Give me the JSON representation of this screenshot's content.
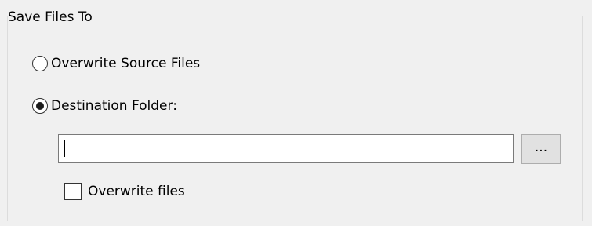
{
  "group": {
    "title": "Save Files To"
  },
  "options": {
    "overwrite_source_label": "Overwrite Source Files",
    "overwrite_source_checked": false,
    "destination_folder_label": "Destination Folder:",
    "destination_folder_checked": true
  },
  "destination": {
    "path_value": "",
    "browse_label": "..."
  },
  "overwrite_files": {
    "label": "Overwrite files",
    "checked": false
  }
}
